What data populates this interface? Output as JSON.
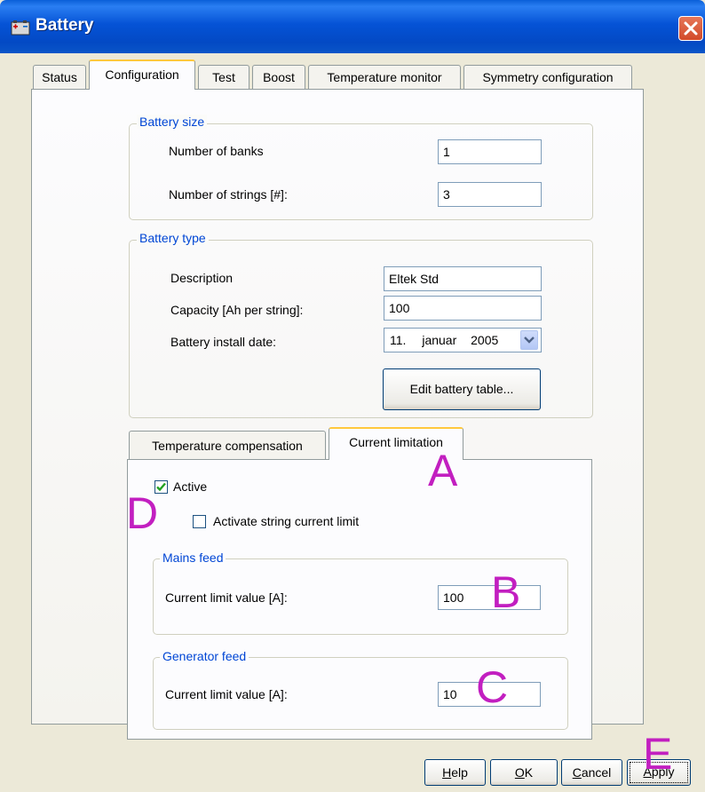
{
  "window": {
    "title": "Battery"
  },
  "tabs": [
    {
      "label": "Status"
    },
    {
      "label": "Configuration"
    },
    {
      "label": "Test"
    },
    {
      "label": "Boost"
    },
    {
      "label": "Temperature monitor"
    },
    {
      "label": "Symmetry configuration"
    }
  ],
  "battery_size": {
    "title": "Battery size",
    "banks_label": "Number of banks",
    "banks_value": "1",
    "strings_label": "Number of strings [#]:",
    "strings_value": "3"
  },
  "battery_type": {
    "title": "Battery type",
    "description_label": "Description",
    "description_value": "Eltek Std",
    "capacity_label": "Capacity [Ah per string]:",
    "capacity_value": "100",
    "install_date_label": "Battery install date:",
    "install_date_day": "11.",
    "install_date_month": "januar",
    "install_date_year": "2005",
    "edit_button": "Edit battery table..."
  },
  "inner_tabs": [
    {
      "label": "Temperature compensation"
    },
    {
      "label": "Current limitation"
    }
  ],
  "current_limitation": {
    "active_label": "Active",
    "active_checked": true,
    "string_limit_label": "Activate string current limit",
    "string_limit_checked": false,
    "mains": {
      "title": "Mains feed",
      "label": "Current limit value [A]:",
      "value": "100"
    },
    "generator": {
      "title": "Generator feed",
      "label": "Current limit value [A]:",
      "value": "10"
    }
  },
  "buttons": {
    "help": "Help",
    "help_key": "H",
    "help_rest": "elp",
    "ok_key": "O",
    "ok_rest": "K",
    "cancel_key": "C",
    "cancel_rest": "ancel",
    "apply_key": "A",
    "apply_rest": "pply"
  },
  "annotations": {
    "a": "A",
    "b": "B",
    "c": "C",
    "d": "D",
    "e": "E"
  },
  "colors": {
    "annotation": "#c21fc0",
    "group_title": "#0046d5",
    "title_bar": "#0553d6",
    "active_tab_top": "#ffc83c"
  }
}
